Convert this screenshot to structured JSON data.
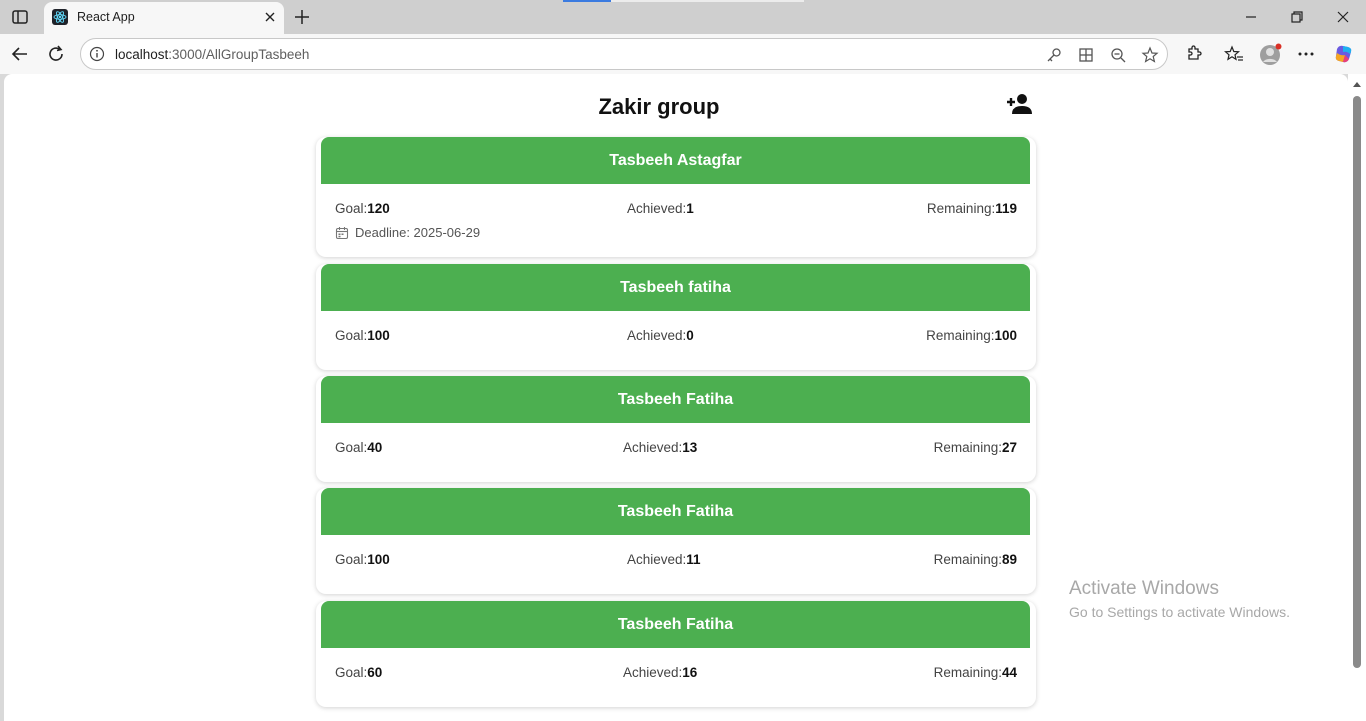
{
  "browser": {
    "tab_title": "React App",
    "url_host": "localhost",
    "url_path": ":3000/AllGroupTasbeeh"
  },
  "page": {
    "title": "Zakir group"
  },
  "labels": {
    "goal": "Goal:",
    "achieved": "Achieved:",
    "remaining": "Remaining:",
    "deadline_prefix": "Deadline: "
  },
  "cards": [
    {
      "name": "Tasbeeh Astagfar",
      "goal": "120",
      "achieved": "1",
      "remaining": "119",
      "deadline": "2025-06-29"
    },
    {
      "name": "Tasbeeh fatiha",
      "goal": "100",
      "achieved": "0",
      "remaining": "100"
    },
    {
      "name": "Tasbeeh Fatiha",
      "goal": "40",
      "achieved": "13",
      "remaining": "27"
    },
    {
      "name": "Tasbeeh Fatiha",
      "goal": "100",
      "achieved": "11",
      "remaining": "89"
    },
    {
      "name": "Tasbeeh Fatiha",
      "goal": "60",
      "achieved": "16",
      "remaining": "44"
    }
  ],
  "watermark": {
    "line1": "Activate Windows",
    "line2": "Go to Settings to activate Windows."
  },
  "colors": {
    "card_header": "#4caf50"
  }
}
